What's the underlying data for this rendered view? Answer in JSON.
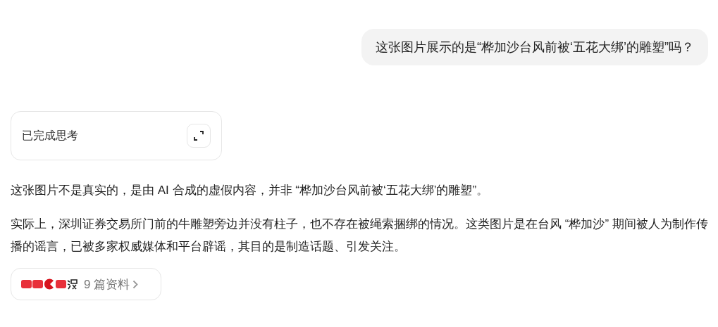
{
  "user_message": "这张图片展示的是“桦加沙台风前被‘五花大绑’的雕塑”吗？",
  "thinking": {
    "label": "已完成思考",
    "expanded": false
  },
  "answer": [
    "这张图片不是真实的，是由 AI 合成的虚假内容，并非 “桦加沙台风前被‘五花大绑’的雕塑”。",
    "实际上，深圳证券交易所门前的牛雕塑旁边并没有柱子，也不存在被绳索捆绑的情况。这类图片是在台风 “桦加沙” 期间被人为制作传播的谣言，已被多家权威媒体和平台辟谣，其目的是制造话题、引发关注。"
  ],
  "sources": {
    "label": "9 篇资料",
    "icons": [
      {
        "kind": "tag",
        "color": "#e8303a"
      },
      {
        "kind": "tag",
        "color": "#e8303a"
      },
      {
        "kind": "circle",
        "color": "#d7141e"
      },
      {
        "kind": "tag",
        "color": "#e8303a"
      },
      {
        "kind": "glyph",
        "color": "#222222"
      }
    ]
  }
}
